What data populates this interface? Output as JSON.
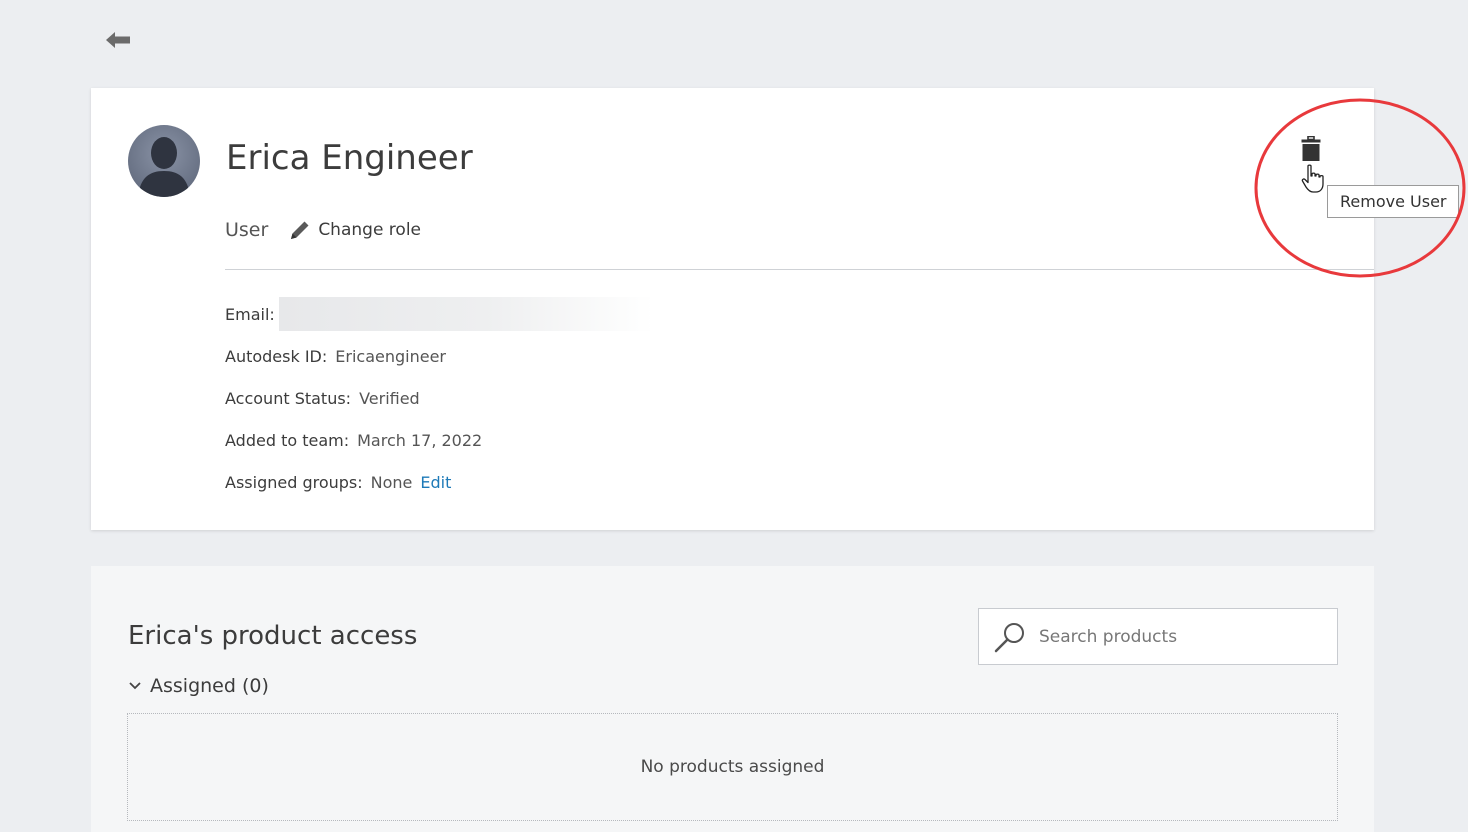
{
  "user": {
    "name": "Erica Engineer",
    "role": "User",
    "change_role_label": "Change role"
  },
  "details": {
    "email_label": "Email:",
    "autodesk_id_label": "Autodesk ID:",
    "autodesk_id_value": "Ericaengineer",
    "account_status_label": "Account Status:",
    "account_status_value": "Verified",
    "added_label": "Added to team:",
    "added_value": "March 17, 2022",
    "groups_label": "Assigned groups:",
    "groups_value": "None",
    "edit_label": "Edit"
  },
  "actions": {
    "remove_tooltip": "Remove User"
  },
  "products": {
    "title": "Erica's product access",
    "search_placeholder": "Search products",
    "assigned_label": "Assigned (0)",
    "empty_message": "No products assigned"
  },
  "icons": {
    "back": "arrow-left-icon",
    "trash": "trash-icon",
    "pencil": "pencil-icon",
    "search": "magnifier-icon",
    "chevron": "chevron-down-icon"
  },
  "colors": {
    "page_bg": "#eceef1",
    "link": "#1e7ab8",
    "highlight": "#e8393c"
  }
}
